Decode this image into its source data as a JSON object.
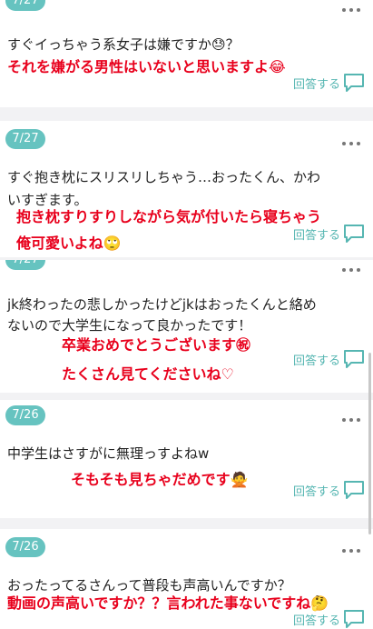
{
  "cards": [
    {
      "date": "7/27",
      "question": "すぐイっちゃう系女子は嫌ですか😓？",
      "answer_lines": [
        "それを嫌がる男性はいないと思いますよ😂"
      ],
      "reply_label": "回答する"
    },
    {
      "date": "7/27",
      "question_lines": [
        "すぐ抱き枕にスリスリしちゃう…おったくん、かわ",
        "いすぎます。"
      ],
      "answer_lines": [
        "抱き枕すりすりしながら気が付いたら寝ちゃう",
        "俺可愛いよね🙄"
      ],
      "reply_label": "回答する"
    },
    {
      "date": "7/27",
      "question_lines": [
        "jk終わったの悲しかったけどjkはおったくんと絡め",
        "ないので大学生になって良かったです！"
      ],
      "answer_lines": [
        "卒業おめでとうございます㊗",
        "たくさん見てくださいね♡"
      ],
      "reply_label": "回答する"
    },
    {
      "date": "7/26",
      "question": "中学生はさすがに無理っすよねw",
      "answer_lines": [
        "そもそも見ちゃだめです🙅"
      ],
      "reply_label": "回答する"
    },
    {
      "date": "7/26",
      "question": "おったってるさんって普段も声高いんですか？",
      "answer_lines": [
        "動画の声高いですか？？言われた事ないですね🤔"
      ],
      "reply_label": "回答する"
    }
  ],
  "colors": {
    "accent": "#66c3c0",
    "answer_red": "#e8001c"
  },
  "icons": {
    "more": "more-dots-icon",
    "reply": "speech-bubble-icon"
  }
}
